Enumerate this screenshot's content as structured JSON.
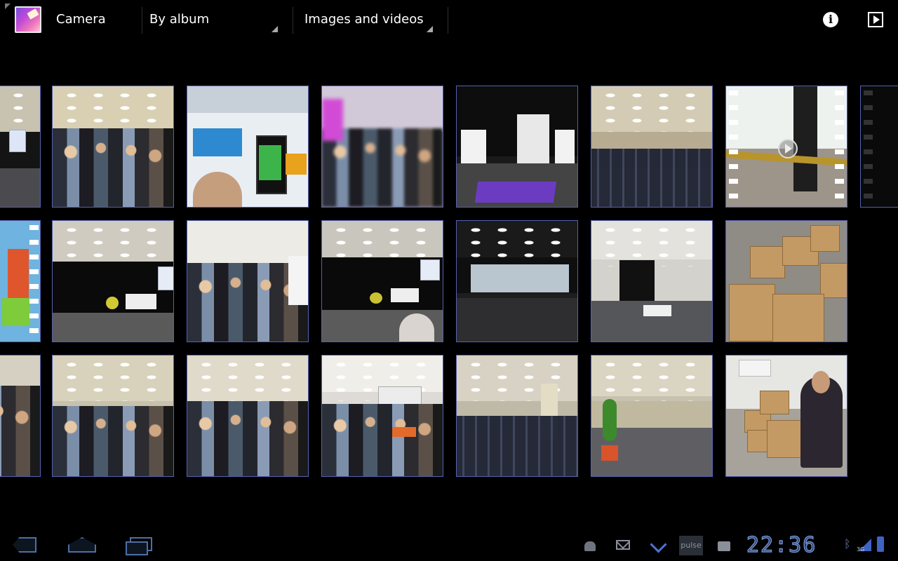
{
  "actionbar": {
    "title": "Camera",
    "cluster_mode": "By album",
    "media_filter": "Images and videos",
    "info_icon": "info-icon",
    "slideshow_icon": "slideshow-play-icon"
  },
  "gallery": {
    "rows": [
      [
        "hall-with-screen",
        "crowd-at-booth",
        "windows-phone-poster",
        "blurred-crowd",
        "kinect-booth",
        "empty-conference-hall",
        "video-clip",
        "video-clip-partial"
      ],
      [
        "angry-birds-screen",
        "stage-presentation",
        "crowd-at-alcatel-booth",
        "stage-presentation",
        "empty-hall-booths",
        "hall-setup",
        "cardboard-boxes"
      ],
      [
        "crowd-partial",
        "crowd-in-hall",
        "expo-crowd",
        "expo-booth-crowd",
        "empty-seat-rows",
        "hall-with-plants",
        "person-with-boxes"
      ]
    ]
  },
  "systembar": {
    "time": "22:36",
    "network": "3G",
    "pulse_label": "pulse",
    "nav_icons": [
      "back-icon",
      "home-icon",
      "recent-apps-icon"
    ],
    "notification_icons": [
      "android-icon",
      "gmail-icon",
      "download-icon",
      "pulse-icon",
      "market-bag-icon"
    ],
    "status_icons": [
      "bluetooth-icon",
      "signal-icon",
      "battery-icon"
    ]
  }
}
